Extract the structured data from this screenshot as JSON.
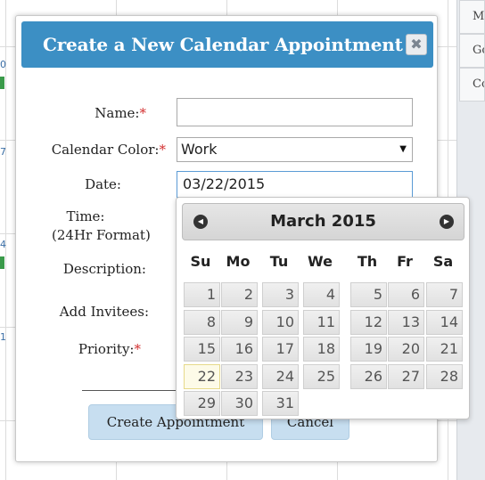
{
  "background": {
    "side_items": [
      "M",
      "Go",
      "Co"
    ]
  },
  "modal": {
    "title": "Create a New Calendar Appointment",
    "close_label": "✖",
    "fields": {
      "name_label": "Name:",
      "name_value": "",
      "color_label": "Calendar Color:",
      "color_value": "Work",
      "date_label": "Date:",
      "date_value": "03/22/2015",
      "time_label_1": "Time:",
      "time_label_2": "(24Hr Format)",
      "description_label": "Description:",
      "invitees_label": "Add Invitees:",
      "priority_label": "Priority:",
      "required_mark": "*"
    },
    "buttons": {
      "create": "Create Appointment",
      "cancel": "Cancel"
    }
  },
  "datepicker": {
    "month": "March",
    "year": "2015",
    "prev_icon": "◀",
    "next_icon": "▶",
    "weekdays": [
      "Su",
      "Mo",
      "Tu",
      "We",
      "Th",
      "Fr",
      "Sa"
    ],
    "days": [
      "1",
      "2",
      "3",
      "4",
      "5",
      "6",
      "7",
      "8",
      "9",
      "10",
      "11",
      "12",
      "13",
      "14",
      "15",
      "16",
      "17",
      "18",
      "19",
      "20",
      "21",
      "22",
      "23",
      "24",
      "25",
      "26",
      "27",
      "28",
      "29",
      "30",
      "31"
    ],
    "highlighted_day": "22"
  },
  "colors": {
    "header_bg": "#3c8fc4",
    "button_bg": "#c7def0",
    "required": "#d32f2f"
  }
}
